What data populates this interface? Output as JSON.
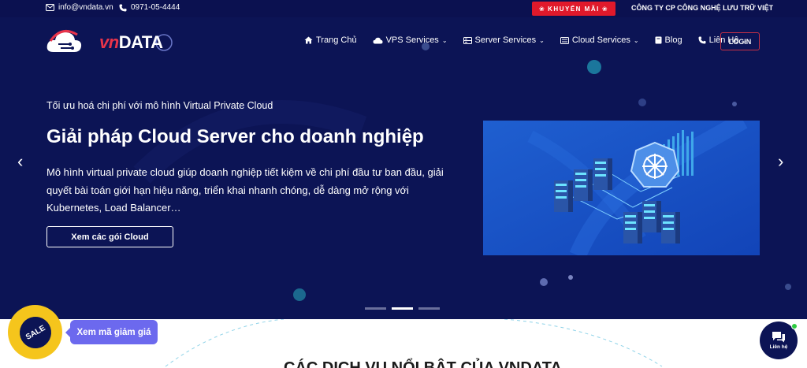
{
  "topbar": {
    "email": "info@vndata.vn",
    "phone": "0971-05-4444",
    "promo_label": "KHUYẾN MÃI",
    "company": "CÔNG TY CP CÔNG NGHỆ LƯU TRỮ VIỆT"
  },
  "header": {
    "logo_prefix": "vn",
    "logo_suffix": "DATA",
    "nav": [
      {
        "label": "Trang Chủ",
        "icon": "home-icon"
      },
      {
        "label": "VPS Services",
        "icon": "cloud-icon",
        "dropdown": true
      },
      {
        "label": "Server Services",
        "icon": "server-icon",
        "dropdown": true
      },
      {
        "label": "Cloud Services",
        "icon": "list-icon",
        "dropdown": true
      },
      {
        "label": "Blog",
        "icon": "book-icon"
      },
      {
        "label": "Liên Hệ",
        "icon": "phone-icon",
        "dropdown": true
      }
    ],
    "login": "LOGIN"
  },
  "hero": {
    "tagline": "Tối ưu hoá chi phí với mô hình Virtual Private Cloud",
    "headline": "Giải pháp Cloud Server cho doanh nghiệp",
    "description": "Mô hình virtual private cloud giúp doanh nghiệp tiết kiệm về chi phí đầu tư ban đầu, giải quyết bài toán giới hạn hiệu năng, triển khai nhanh chóng, dễ dàng mở rộng với Kubernetes, Load Balancer…",
    "cta": "Xem các gói Cloud",
    "slides_total": 3,
    "active_slide": 2
  },
  "section": {
    "title": "CÁC DỊCH VỤ NỔI BẬT CỦA VNDATA"
  },
  "floating": {
    "sale_badge": "SALE",
    "coupon": "Xem mã giảm giá",
    "chat_label": "Liên hệ"
  },
  "colors": {
    "hero_bg": "#0c1455",
    "topbar_bg": "#0b1150",
    "promo": "#e0192b",
    "accent_purple": "#6c69ee",
    "sale_yellow": "#f5c51c"
  }
}
